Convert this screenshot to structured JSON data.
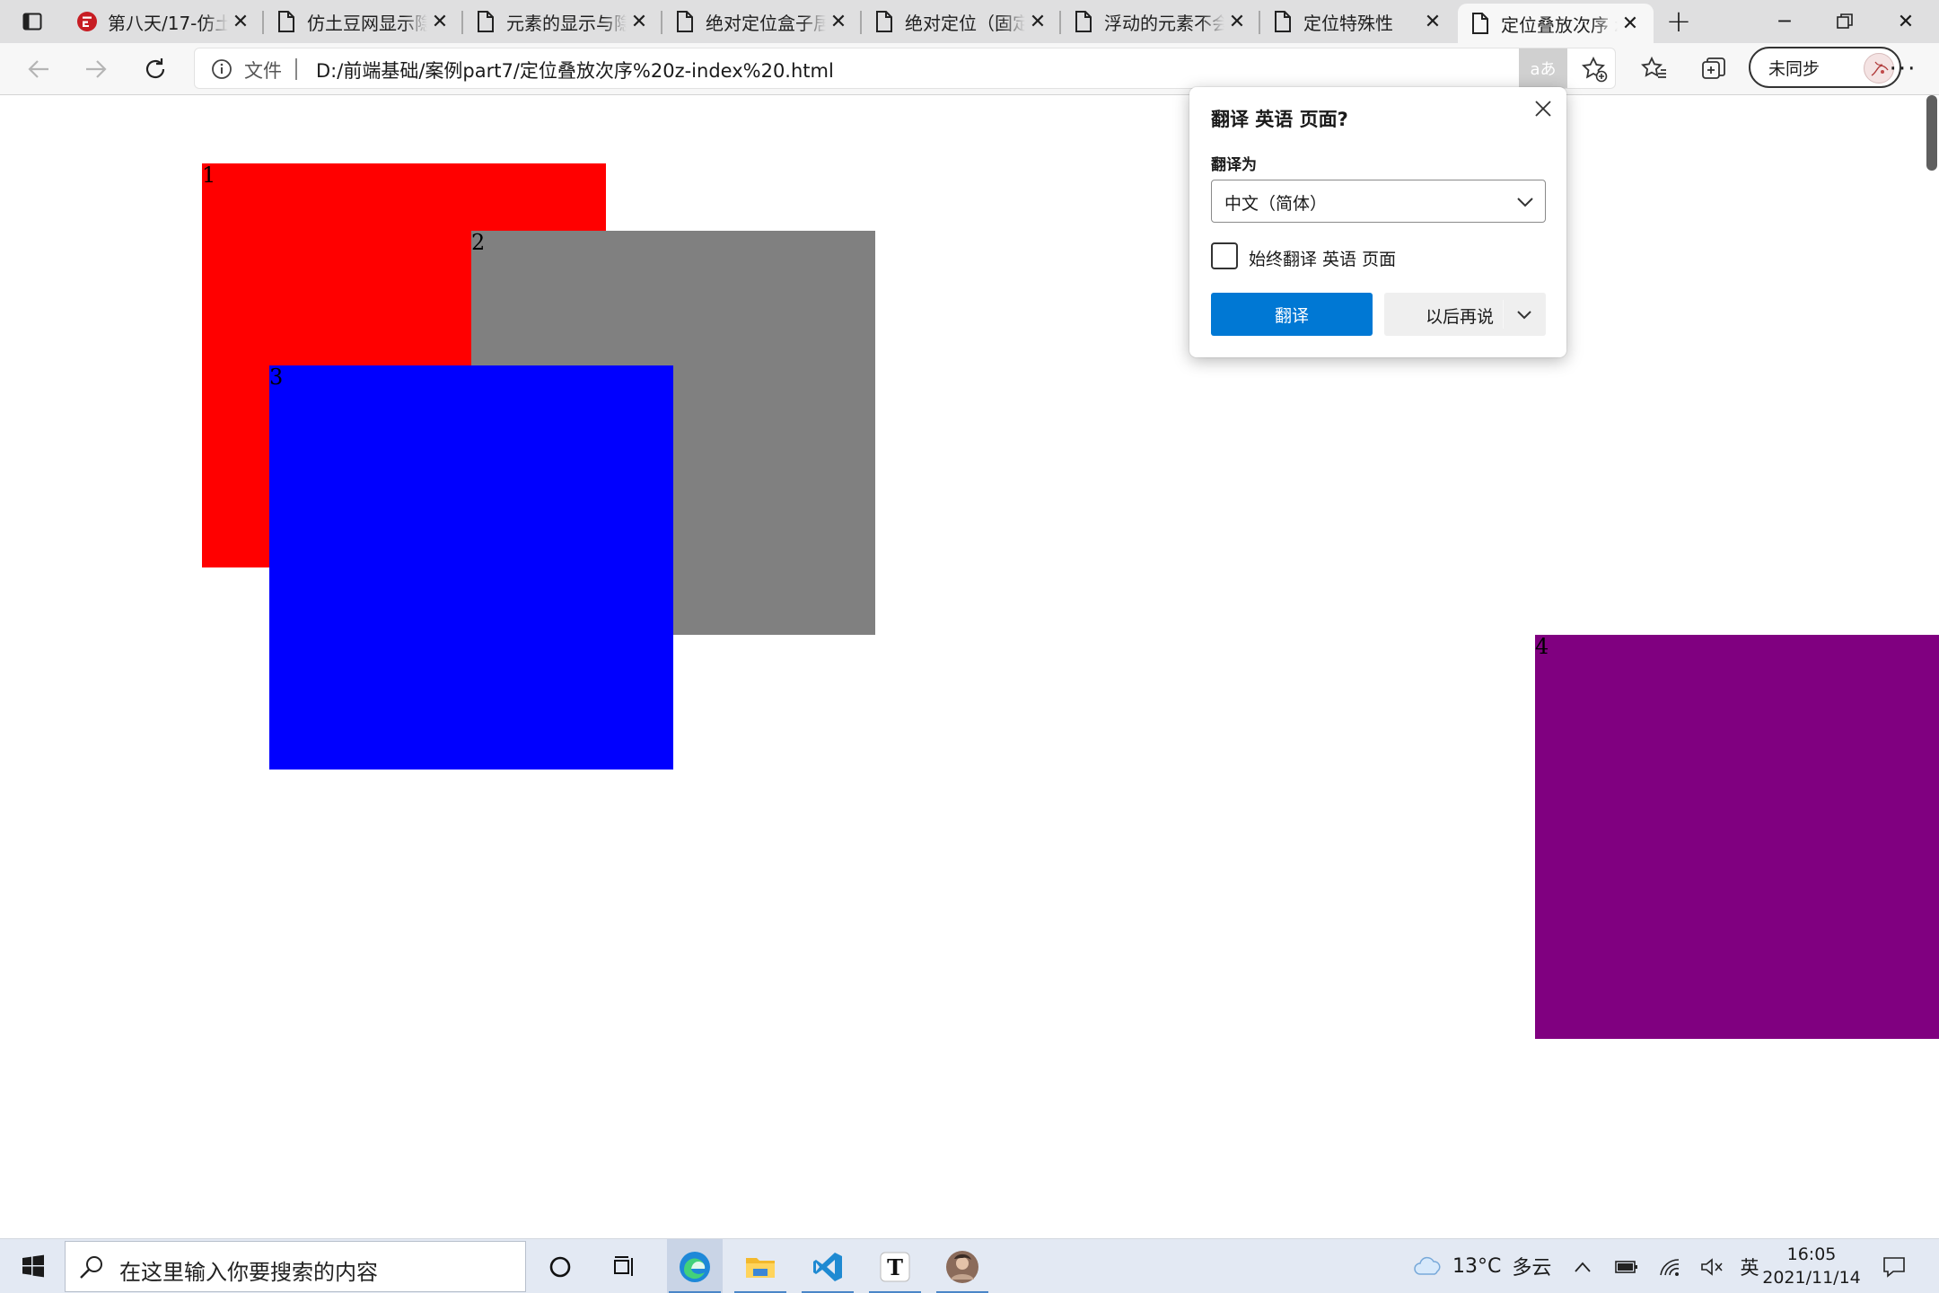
{
  "browser": {
    "tabs": [
      {
        "label": "第八天/17-仿土",
        "icon": "gitee-icon"
      },
      {
        "label": "仿土豆网显示隐",
        "icon": "file-icon"
      },
      {
        "label": "元素的显示与隐",
        "icon": "file-icon"
      },
      {
        "label": "绝对定位盒子居",
        "icon": "file-icon"
      },
      {
        "label": "绝对定位（固定",
        "icon": "file-icon"
      },
      {
        "label": "浮动的元素不会",
        "icon": "file-icon"
      },
      {
        "label": "定位特殊性",
        "icon": "file-icon"
      },
      {
        "label": "定位叠放次序 z",
        "icon": "file-icon",
        "active": true
      }
    ],
    "address_bar": {
      "file_label": "文件",
      "url": "D:/前端基础/案例part7/定位叠放次序%20z-index%20.html",
      "translate_badge": "aあ"
    },
    "sync_label": "未同步"
  },
  "page": {
    "boxes": [
      {
        "label": "1",
        "color": "#ff0000"
      },
      {
        "label": "2",
        "color": "#808080"
      },
      {
        "label": "3",
        "color": "#0000ff"
      },
      {
        "label": "4",
        "color": "#800080"
      }
    ]
  },
  "translate_popup": {
    "title": "翻译 英语 页面?",
    "translate_to_label": "翻译为",
    "selected_language": "中文（简体）",
    "always_translate_label": "始终翻译 英语 页面",
    "always_translate_checked": false,
    "translate_button": "翻译",
    "later_button": "以后再说",
    "accent_color": "#0078d4"
  },
  "taskbar": {
    "search_placeholder": "在这里输入你要搜索的内容",
    "weather": {
      "temperature": "13°C",
      "condition": "多云"
    },
    "input_method": "英",
    "clock": {
      "time": "16:05",
      "date": "2021/11/14"
    }
  }
}
